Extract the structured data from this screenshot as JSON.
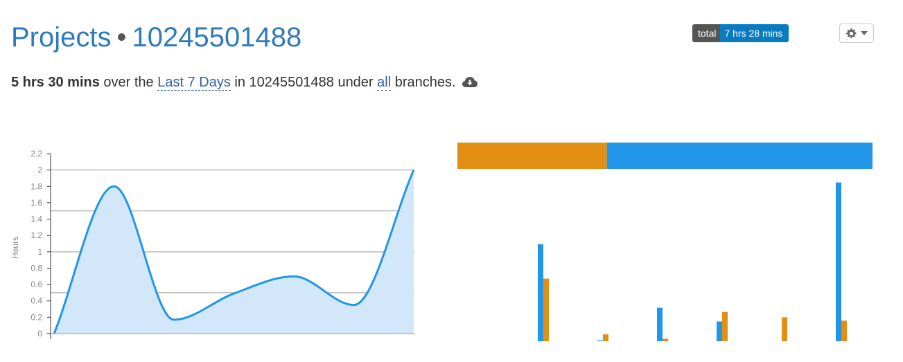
{
  "header": {
    "section": "Projects",
    "separator": "•",
    "project_name": "10245501488",
    "badge_label": "total",
    "badge_value": "7 hrs 28 mins",
    "settings_icon": "gear-icon",
    "dropdown_icon": "caret-down-icon"
  },
  "summary": {
    "total_time": "5 hrs 30 mins",
    "text_over": "over the",
    "range_link": "Last 7 Days",
    "text_in": "in 10245501488 under",
    "branch_link": "all",
    "text_end": "branches.",
    "download_icon": "cloud-download-icon"
  },
  "colors": {
    "accent": "#2d7bbd",
    "series_blue": "#2196e9",
    "series_orange": "#e38f14",
    "area_fill": "#d2e8fa"
  },
  "chart_data": [
    {
      "type": "area",
      "ylabel": "Hours",
      "ylim": [
        0,
        2.2
      ],
      "yticks": [
        "0",
        "0.2",
        "0.4",
        "0.6",
        "0.8",
        "1",
        "1.2",
        "1.4",
        "1.6",
        "1.8",
        "2",
        "2.2"
      ],
      "ytick_values": [
        0,
        0.2,
        0.4,
        0.6,
        0.8,
        1,
        1.2,
        1.4,
        1.6,
        1.8,
        2,
        2.2
      ],
      "gridlines": [
        0.5,
        1.0,
        1.5,
        2.0
      ],
      "x": [
        0,
        1,
        2,
        3,
        4,
        5,
        6
      ],
      "values": [
        0,
        1.8,
        0.17,
        0.49,
        0.7,
        0.35,
        2.0
      ]
    },
    {
      "type": "bar",
      "stacked_total_bar": [
        {
          "color": "orange",
          "share": 0.36
        },
        {
          "color": "blue",
          "share": 0.64
        }
      ],
      "series": [
        {
          "color": "blue",
          "values": [
            1.13,
            0.01,
            0.39,
            0.23,
            0,
            1.85
          ]
        },
        {
          "color": "orange",
          "values": [
            0.73,
            0.08,
            0.03,
            0.34,
            0.28,
            0.24
          ]
        }
      ],
      "ylim": [
        0,
        2.0
      ]
    }
  ]
}
